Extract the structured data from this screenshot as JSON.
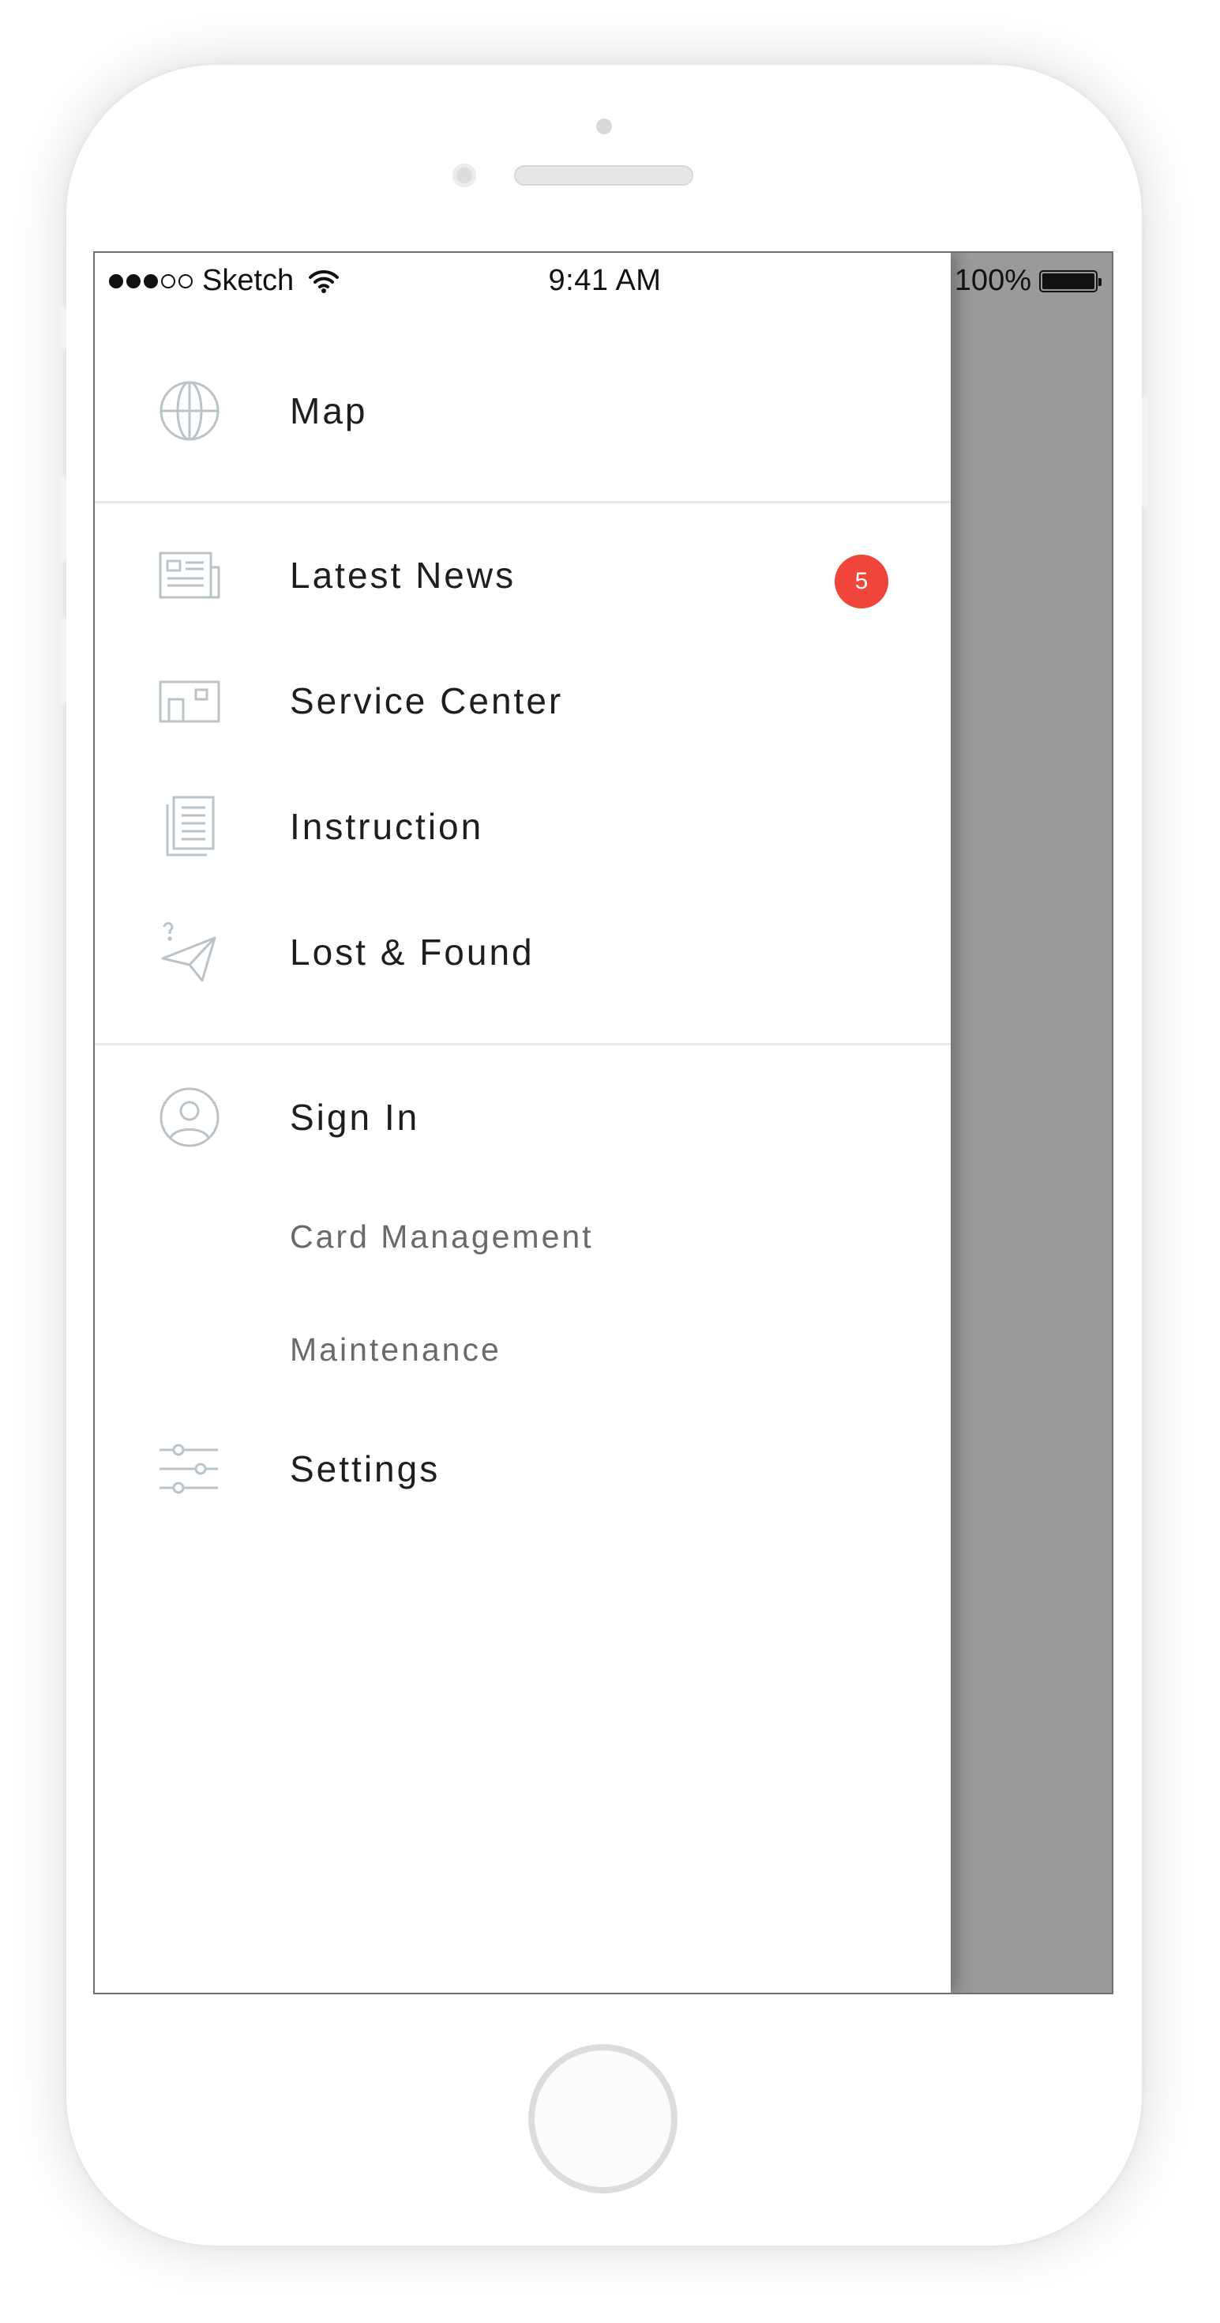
{
  "status_bar": {
    "carrier": "Sketch",
    "time": "9:41 AM",
    "battery": "100%"
  },
  "menu": {
    "map": {
      "label": "Map",
      "icon": "globe-icon"
    },
    "latest_news": {
      "label": "Latest News",
      "icon": "newspaper-icon",
      "badge": "5"
    },
    "service_center": {
      "label": "Service Center",
      "icon": "storefront-icon"
    },
    "instruction": {
      "label": "Instruction",
      "icon": "document-icon"
    },
    "lost_found": {
      "label": "Lost & Found",
      "icon": "paper-plane-question-icon"
    },
    "sign_in": {
      "label": "Sign In",
      "icon": "user-circle-icon"
    },
    "card_management": {
      "label": "Card Management"
    },
    "maintenance": {
      "label": "Maintenance"
    },
    "settings": {
      "label": "Settings",
      "icon": "sliders-icon"
    }
  },
  "colors": {
    "badge": "#f0453a",
    "icon_stroke": "#b9c3c9",
    "overlay": "#9a9a9a"
  }
}
